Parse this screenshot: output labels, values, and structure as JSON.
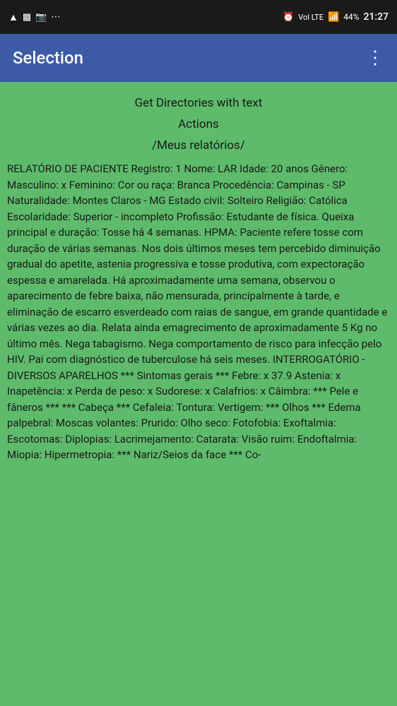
{
  "statusBar": {
    "battery": "44%",
    "time": "21:27",
    "signal": "Vol LTE"
  },
  "appBar": {
    "title": "Selection",
    "menuIcon": "⋮"
  },
  "content": {
    "directoriesLabel": "Get Directories with text",
    "actionsLabel": "Actions",
    "meusLabel": "/Meus relatórios/",
    "reportText": "RELATÓRIO DE PACIENTE Registro: 1 Nome: LAR Idade: 20 anos Gênero: Masculino: x Feminino: Cor ou raça: Branca Procedência: Campinas - SP Naturalidade: Montes Claros - MG Estado civil: Solteiro Religião: Católica Escolaridade: Superior - incompleto Profissão: Estudante de física. Queixa principal e duração: Tosse há 4 semanas. HPMA: Paciente refere tosse com duração de várias semanas. Nos dois últimos meses tem percebido diminuição gradual do apetite, astenia progressiva e tosse produtiva, com expectoração espessa e amarelada. Há aproximadamente uma semana, observou o aparecimento de febre baixa, não mensurada, principalmente à tarde, e eliminação de escarro esverdeado com raias de sangue, em grande quantidade e várias vezes ao dia. Relata ainda emagrecimento de aproximadamente 5 Kg no último mês. Nega tabagismo. Nega comportamento de risco para infecção pelo HIV. Pai com diagnóstico de tuberculose há seis meses. INTERROGATÓRIO - DIVERSOS APARELHOS *** Sintomas gerais *** Febre: x 37.9 Astenia: x Inapetência: x Perda de peso: x Sudorese: x Calafrios: x Câimbra: *** Pele e fâneros *** *** Cabeça *** Cefaleia: Tontura: Vertigem: *** Olhos *** Edema palpebral: Moscas volantes: Prurido: Olho seco: Fotofobia: Exoftalmia: Escotomas: Diplopias: Lacrimejamento: Catarata: Visão ruim: Endoftalmia: Miopia: Hipermetropia: *** Nariz/Seios da face *** Co-"
  }
}
